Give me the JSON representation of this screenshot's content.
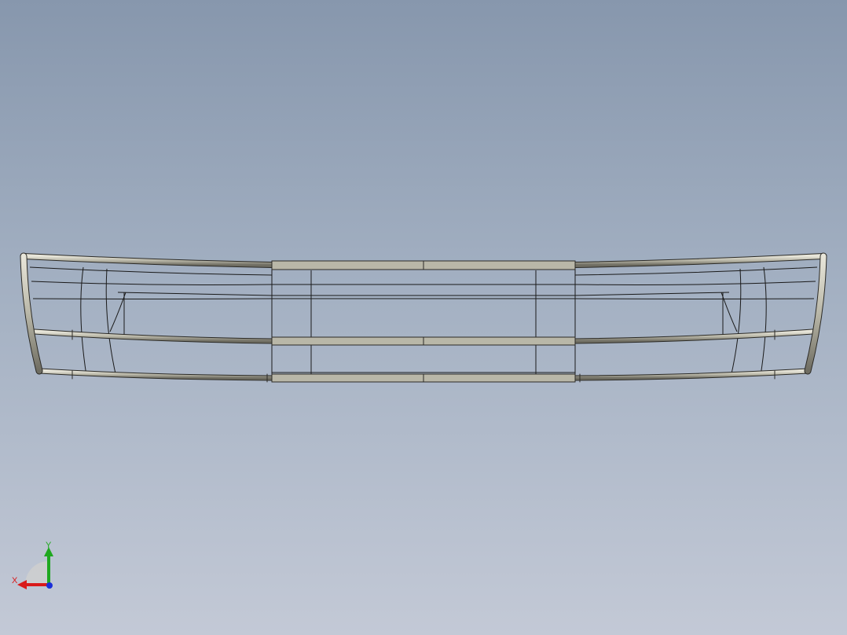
{
  "viewport": {
    "background_top": "#8797ad",
    "background_bottom": "#c3c9d6"
  },
  "model": {
    "name": "bumper-grille-wireframe",
    "tube_color": "#b9b7a8",
    "edge_color": "#1a1a1a"
  },
  "triad": {
    "x_label": "X",
    "y_label": "Y",
    "x_color": "#d91a1a",
    "y_color": "#1fa81f",
    "z_color": "#1a2fd9"
  }
}
